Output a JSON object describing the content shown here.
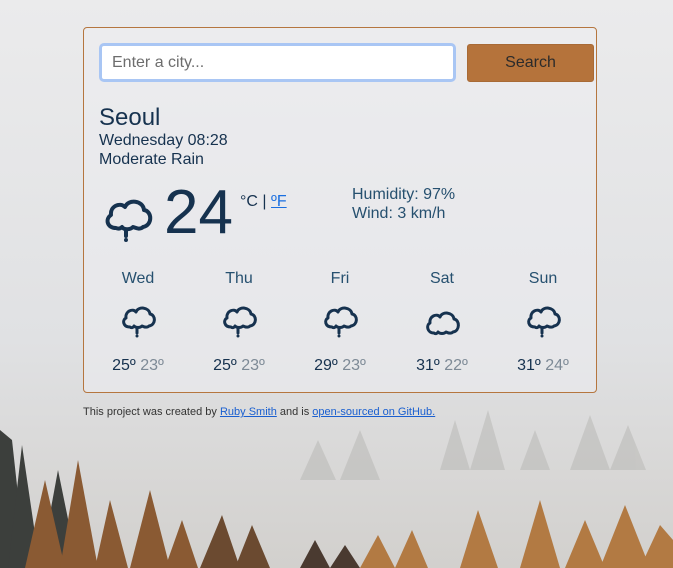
{
  "search": {
    "placeholder": "Enter a city...",
    "value": "",
    "button_label": "Search"
  },
  "current": {
    "city": "Seoul",
    "datetime": "Wednesday 08:28",
    "description": "Moderate Rain",
    "temperature": "24",
    "unit_celsius": "°C",
    "unit_separator": "|",
    "unit_fahrenheit": "ºF",
    "humidity": "Humidity: 97%",
    "wind": "Wind: 3 km/h",
    "icon": "cloud-rain-icon"
  },
  "forecast": [
    {
      "day": "Wed",
      "max": "25º",
      "min": "23º",
      "icon": "cloud-rain-icon"
    },
    {
      "day": "Thu",
      "max": "25º",
      "min": "23º",
      "icon": "cloud-rain-icon"
    },
    {
      "day": "Fri",
      "max": "29º",
      "min": "23º",
      "icon": "cloud-rain-icon"
    },
    {
      "day": "Sat",
      "max": "31º",
      "min": "22º",
      "icon": "cloud-icon"
    },
    {
      "day": "Sun",
      "max": "31º",
      "min": "24º",
      "icon": "cloud-rain-icon"
    }
  ],
  "footer": {
    "prefix": "This project was created by",
    "author_link": "Ruby Smith",
    "middle": "and is",
    "repo_link": "open-sourced on GitHub."
  },
  "colors": {
    "accent": "#b5733b",
    "text": "#16324f",
    "link": "#1a6fe0"
  }
}
